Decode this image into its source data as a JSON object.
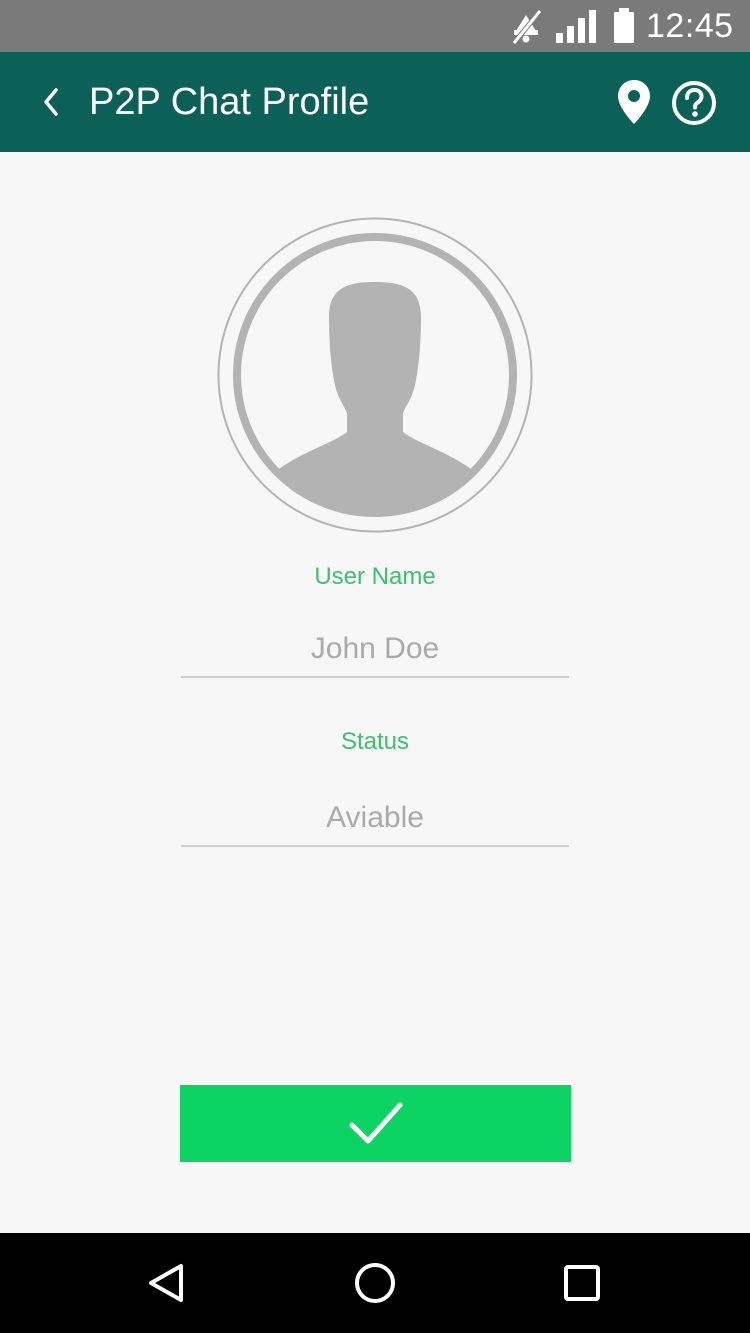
{
  "status_bar": {
    "time": "12:45",
    "icons": [
      "mute-icon",
      "signal-icon",
      "battery-icon"
    ]
  },
  "app_bar": {
    "title": "P2P Chat Profile",
    "icons": [
      "back-arrow-icon",
      "location-pin-icon",
      "help-circle-icon"
    ]
  },
  "profile": {
    "avatar_icon": "person-silhouette-icon"
  },
  "form": {
    "username_label": "User Name",
    "username_value": "John Doe",
    "status_label": "Status",
    "status_value": "Aviable"
  },
  "confirm_button": {
    "icon": "checkmark-icon"
  },
  "nav_bar": {
    "icons": [
      "back-triangle-icon",
      "home-circle-icon",
      "recents-square-icon"
    ]
  },
  "colors": {
    "status_bar": "#7a7a7a",
    "app_bar": "#0b6157",
    "label_accent": "#3fc06f",
    "confirm": "#0cd463",
    "background": "#f7f7f7",
    "nav_bar": "#000000"
  }
}
